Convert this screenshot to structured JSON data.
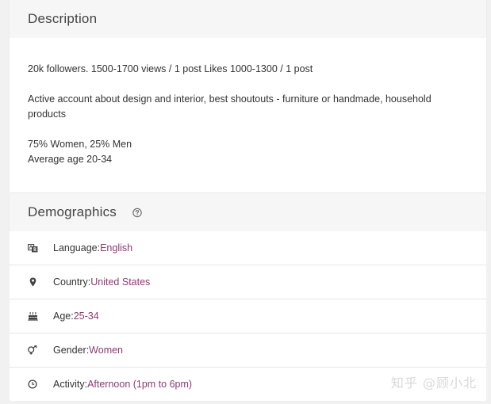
{
  "description": {
    "title": "Description",
    "paragraphs": [
      "20k followers. 1500-1700 views / 1 post Likes 1000-1300 / 1 post",
      "Active account about design and interior, best shoutouts - furniture or handmade, household products",
      "75% Women, 25% Men",
      "Average age 20-34"
    ]
  },
  "demographics": {
    "title": "Demographics",
    "help_icon": "question-circle-icon",
    "rows": [
      {
        "icon": "language-icon",
        "label": "Language: ",
        "value": "English"
      },
      {
        "icon": "location-pin-icon",
        "label": "Country: ",
        "value": "United States"
      },
      {
        "icon": "cake-icon",
        "label": "Age: ",
        "value": "25-34"
      },
      {
        "icon": "gender-icon",
        "label": "Gender: ",
        "value": "Women"
      },
      {
        "icon": "clock-icon",
        "label": "Activity: ",
        "value": "Afternoon (1pm to 6pm)"
      }
    ]
  },
  "watermark": "知乎 @顾小北",
  "colors": {
    "value_accent": "#8b3b73",
    "header_bg": "#f6f6f6",
    "page_bg": "#f1f1f1"
  }
}
